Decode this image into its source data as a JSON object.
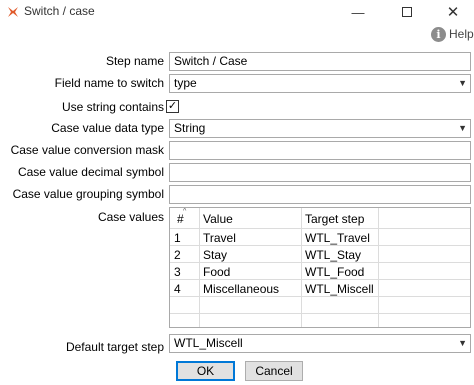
{
  "window": {
    "title": "Switch / case",
    "icon": "spoon-icon",
    "minimize_label": "—",
    "close_label": "✕"
  },
  "help": {
    "label": "Help",
    "icon": "help-circle-icon"
  },
  "form": {
    "step_name_label": "Step name",
    "step_name_value": "Switch / Case",
    "field_name_label": "Field name to switch",
    "field_name_value": "type",
    "use_string_contains_label": "Use string contains",
    "use_string_contains_checked": true,
    "case_value_type_label": "Case value data type",
    "case_value_type_value": "String",
    "conversion_mask_label": "Case value conversion mask",
    "conversion_mask_value": "",
    "decimal_symbol_label": "Case value decimal symbol",
    "decimal_symbol_value": "",
    "grouping_symbol_label": "Case value grouping symbol",
    "grouping_symbol_value": "",
    "case_values_label": "Case values",
    "default_target_label": "Default target step",
    "default_target_value": "WTL_Miscell"
  },
  "grid": {
    "headers": {
      "num": "#",
      "value": "Value",
      "target": "Target step"
    },
    "rows": [
      {
        "num": "1",
        "value": "Travel",
        "target": "WTL_Travel"
      },
      {
        "num": "2",
        "value": "Stay",
        "target": "WTL_Stay"
      },
      {
        "num": "3",
        "value": "Food",
        "target": "WTL_Food"
      },
      {
        "num": "4",
        "value": "Miscellaneous",
        "target": "WTL_Miscell"
      }
    ]
  },
  "buttons": {
    "ok": "OK",
    "cancel": "Cancel"
  },
  "colors": {
    "accent": "#0078d7",
    "app_icon": "#e05a2b"
  }
}
